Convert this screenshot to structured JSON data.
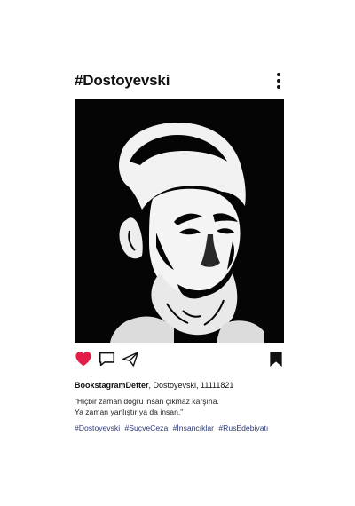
{
  "post": {
    "title": "#Dostoyevski",
    "image_alt": "Fyodor Dostoyevski portrait",
    "username": "BookstagramDefter",
    "caption_rest": ", Dostoyevski, 11111821",
    "quote_line1": "“Hiçbir zaman doğru insan çıkmaz karşına.",
    "quote_line2": "Ya zaman yanlıştır ya da insan.”",
    "tags": [
      "#Dostoyevski",
      "#SuçveCeza",
      "#İnsancıklar",
      "#RusEdebiyatı"
    ]
  },
  "icons": {
    "more": "more-vertical-icon",
    "like": "heart-icon",
    "comment": "comment-icon",
    "share": "send-icon",
    "save": "bookmark-icon"
  },
  "colors": {
    "like": "#e11d48",
    "photo_bg": "#050505",
    "tag": "#2b3a7a"
  }
}
